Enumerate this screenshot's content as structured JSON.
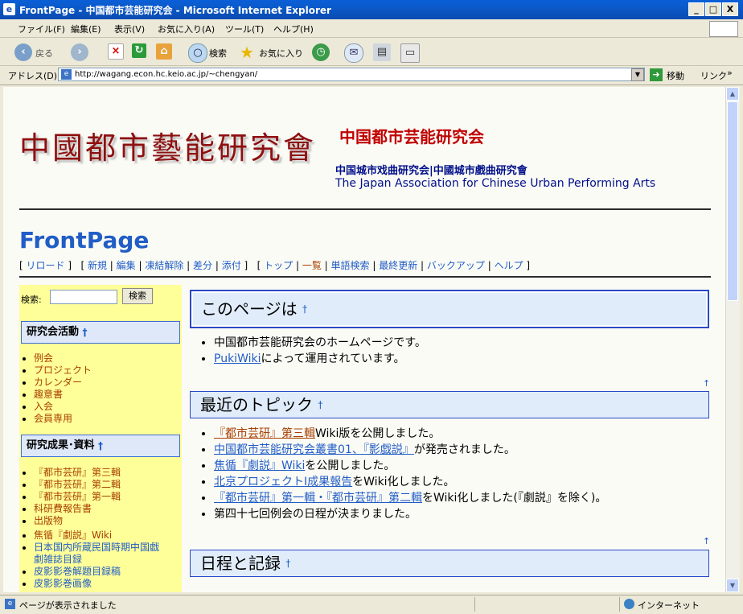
{
  "window": {
    "title": "FrontPage - 中国都市芸能研究会 - Microsoft Internet Explorer",
    "min": "_",
    "max": "□",
    "close": "X"
  },
  "menu": [
    "ファイル(F)",
    "編集(E)",
    "表示(V)",
    "お気に入り(A)",
    "ツール(T)",
    "ヘルプ(H)"
  ],
  "toolbar": {
    "back": "戻る",
    "search": "検索",
    "favorites": "お気に入り"
  },
  "address": {
    "label": "アドレス(D)",
    "url": "http://wagang.econ.hc.keio.ac.jp/~chengyan/",
    "go": "移動",
    "links": "リンク"
  },
  "header": {
    "logo_text": "中國都市藝能研究會",
    "site_title": "中国都市芸能研究会",
    "sub_cn": "中国城市戏曲研究会|中國城市戲曲研究會",
    "sub_en": "The Japan Association for Chinese Urban Performing Arts"
  },
  "page_title": "FrontPage",
  "nav": {
    "group1": [
      "リロード"
    ],
    "group2": [
      "新規",
      "編集",
      "凍結解除",
      "差分",
      "添付"
    ],
    "group3": [
      "トップ",
      "一覧",
      "単語検索",
      "最終更新",
      "バックアップ",
      "ヘルプ"
    ]
  },
  "sidebar": {
    "search_label": "検索:",
    "search_button": "検索",
    "sec1_title": "研究会活動",
    "sec1_items": [
      "例会",
      "プロジェクト",
      "カレンダー",
      "趣意書",
      "入会",
      "会員専用"
    ],
    "sec2_title": "研究成果･資料",
    "sec2_items": [
      "『都市芸研』第三輯",
      "『都市芸研』第二輯",
      "『都市芸研』第一輯",
      "科研費報告書",
      "出版物"
    ],
    "sec2_items_b": [
      "焦循『劇説』Wiki",
      "日本国内所蔵民国時期中国戯",
      "劇雑誌目録",
      "皮影影巻解題目録稿",
      "皮影影巻画像"
    ]
  },
  "main": {
    "sec1_title": "このページは",
    "sec1_items": [
      "中国都市芸能研究会のホームページです。",
      "PukiWiki",
      "によって運用されています。"
    ],
    "sec2_title": "最近のトピック",
    "topics": [
      {
        "link": "『都市芸研』第三輯",
        "rest": "Wiki版を公開しました。"
      },
      {
        "link": "中国都市芸能研究会叢書01、『影戯説』",
        "rest": "が発売されました。"
      },
      {
        "link": "焦循『劇説』Wiki",
        "rest": "を公開しました。"
      },
      {
        "link": "北京プロジェクトⅠ成果報告",
        "rest": "をWiki化しました。"
      },
      {
        "link": "『都市芸研』第一輯・『都市芸研』第二輯",
        "rest": "をWiki化しました(『劇説』を除く)。"
      },
      {
        "link": "",
        "rest": "第四十七回例会の日程が決まりました。"
      }
    ],
    "sec3_title": "日程と記録",
    "dagger": "†",
    "up_arrow": "↑"
  },
  "status": {
    "text": "ページが表示されました",
    "zone": "インターネット"
  }
}
